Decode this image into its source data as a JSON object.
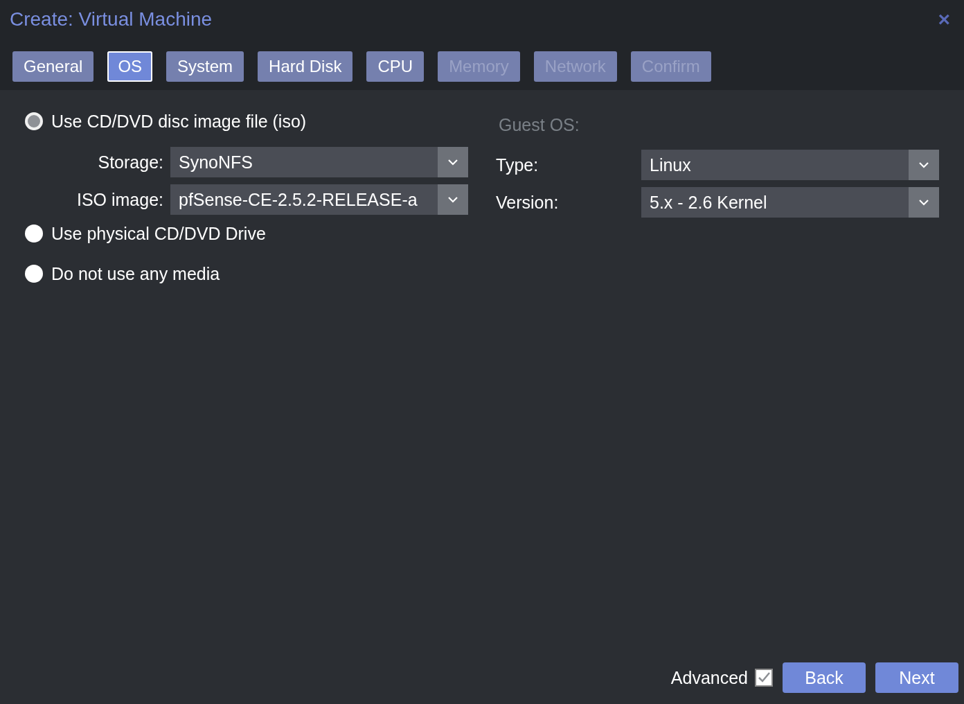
{
  "window": {
    "title": "Create: Virtual Machine",
    "close": "×"
  },
  "tabs": [
    {
      "label": "General",
      "selected": false,
      "disabled": false
    },
    {
      "label": "OS",
      "selected": true,
      "disabled": false
    },
    {
      "label": "System",
      "selected": false,
      "disabled": false
    },
    {
      "label": "Hard Disk",
      "selected": false,
      "disabled": false
    },
    {
      "label": "CPU",
      "selected": false,
      "disabled": false
    },
    {
      "label": "Memory",
      "selected": false,
      "disabled": true
    },
    {
      "label": "Network",
      "selected": false,
      "disabled": true
    },
    {
      "label": "Confirm",
      "selected": false,
      "disabled": true
    }
  ],
  "media": [
    {
      "label": "Use CD/DVD disc image file (iso)",
      "selected": true,
      "fields": [
        {
          "label": "Storage:",
          "value": "SynoNFS"
        },
        {
          "label": "ISO image:",
          "value": "pfSense-CE-2.5.2-RELEASE-a"
        }
      ]
    },
    {
      "label": "Use physical CD/DVD Drive",
      "selected": false
    },
    {
      "label": "Do not use any media",
      "selected": false
    }
  ],
  "guest_os": {
    "heading": "Guest OS:",
    "fields": [
      {
        "label": "Type:",
        "value": "Linux"
      },
      {
        "label": "Version:",
        "value": "5.x - 2.6 Kernel"
      }
    ]
  },
  "footer": {
    "advanced": {
      "label": "Advanced",
      "checked": true
    },
    "buttons": [
      "Back",
      "Next"
    ]
  }
}
